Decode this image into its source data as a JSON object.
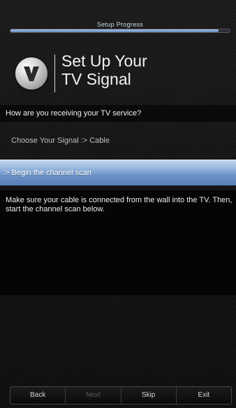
{
  "progress": {
    "label": "Setup Progress",
    "value": 0.95
  },
  "header": {
    "title_line1": "Set Up Your",
    "title_line2": "TV Signal",
    "logo": "vizio-v-logo"
  },
  "question": "How are you receiving your TV service?",
  "signal": {
    "text": "Choose Your Signal :> Cable"
  },
  "scan": {
    "text": ":> Begin the channel scan"
  },
  "info": "Make sure your cable is connected from the wall into the TV. Then, start the channel scan below.",
  "footer": {
    "back": "Back",
    "next": "Next",
    "skip": "Skip",
    "exit": "Exit"
  },
  "colors": {
    "accent": "#6b93c8",
    "highlight_top": "#c4d7f0",
    "background": "#111111"
  }
}
